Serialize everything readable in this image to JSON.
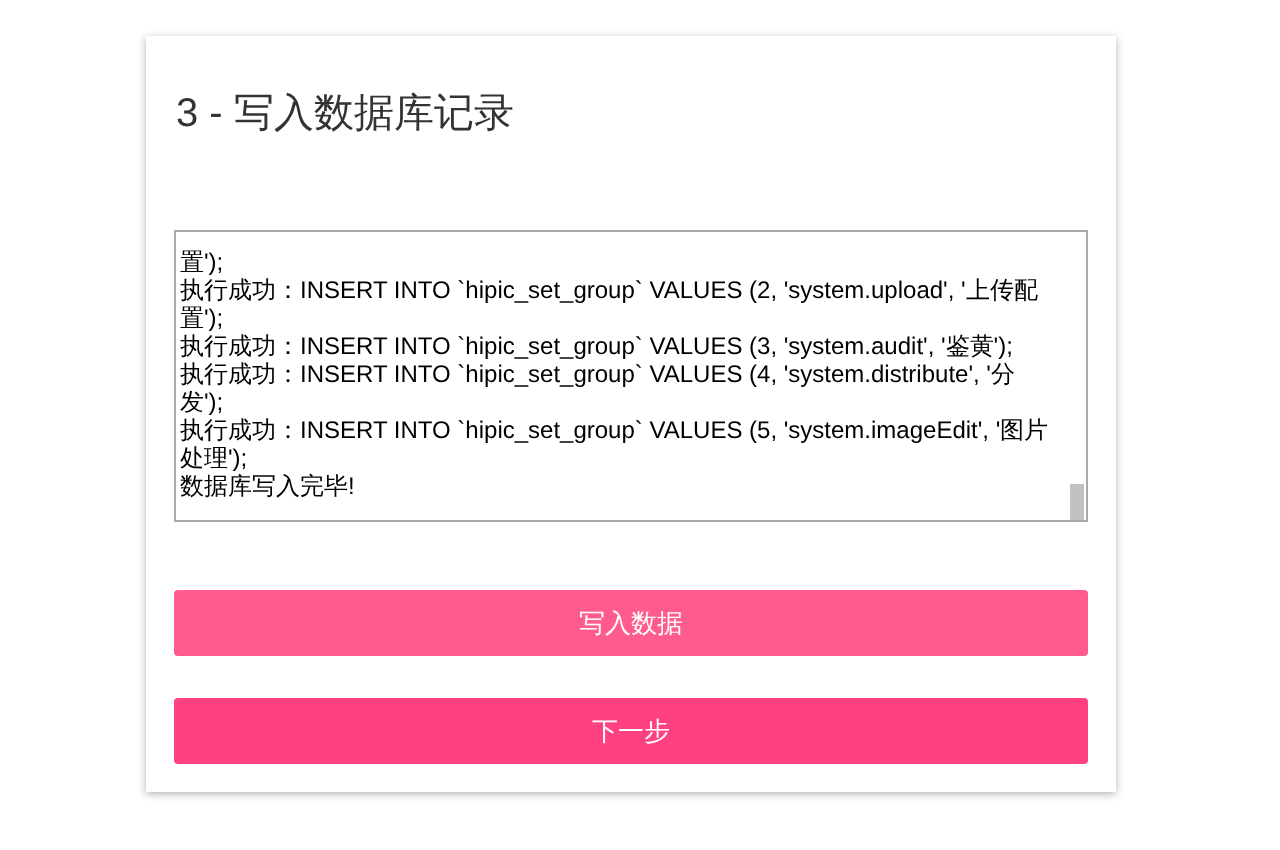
{
  "title": "3 - 写入数据库记录",
  "log": [
    "置');",
    "执行成功：INSERT INTO `hipic_set_group` VALUES (2, 'system.upload', '上传配置');",
    "执行成功：INSERT INTO `hipic_set_group` VALUES (3, 'system.audit', '鉴黄');",
    "执行成功：INSERT INTO `hipic_set_group` VALUES (4, 'system.distribute', '分发');",
    "执行成功：INSERT INTO `hipic_set_group` VALUES (5, 'system.imageEdit', '图片处理');",
    "数据库写入完毕!"
  ],
  "buttons": [
    {
      "label": "写入数据",
      "disabled": true
    },
    {
      "label": "下一步",
      "disabled": false
    }
  ]
}
